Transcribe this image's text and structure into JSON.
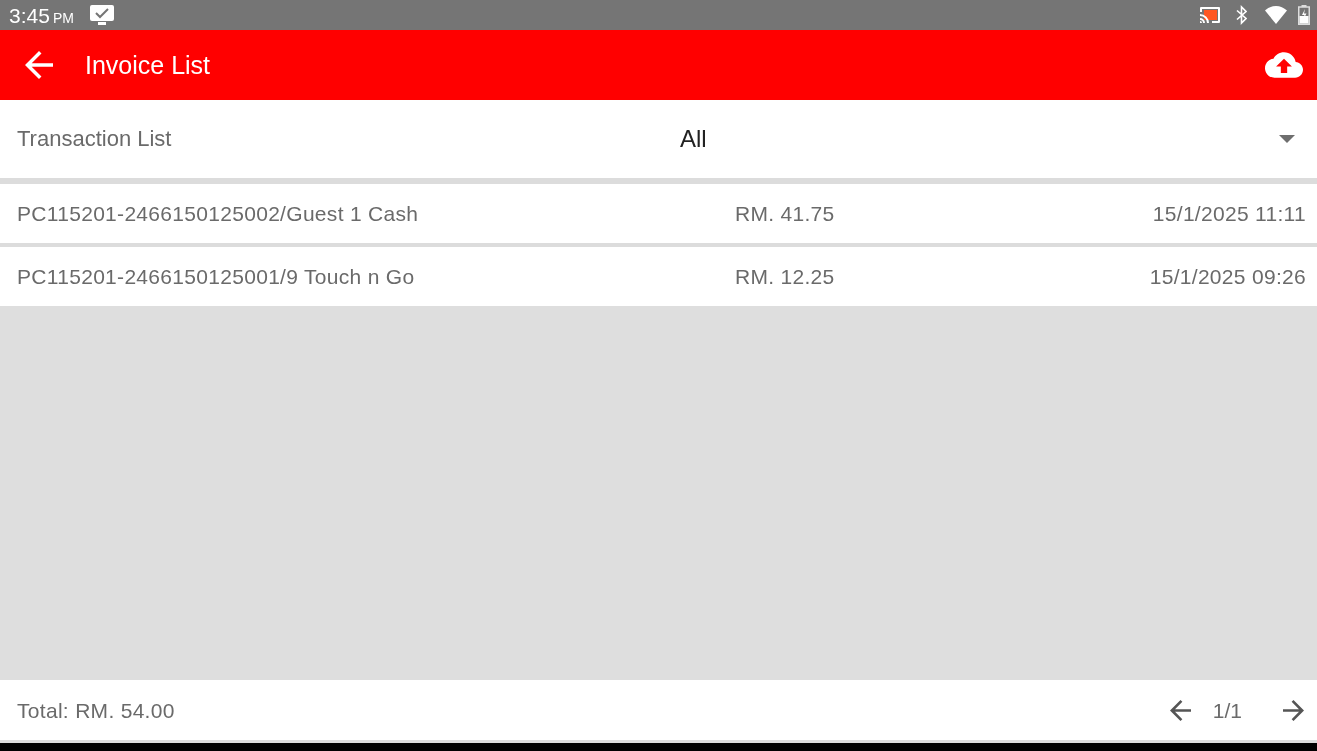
{
  "status_bar": {
    "time": "3:45",
    "meridiem": "PM"
  },
  "app_bar": {
    "title": "Invoice List"
  },
  "filter": {
    "label": "Transaction List",
    "value": "All"
  },
  "transactions": [
    {
      "reference": "PC115201-2466150125002/Guest 1 Cash",
      "amount": "RM. 41.75",
      "date": "15/1/2025 11:11"
    },
    {
      "reference": "PC115201-2466150125001/9 Touch n Go",
      "amount": "RM. 12.25",
      "date": "15/1/2025 09:26"
    }
  ],
  "footer": {
    "total": "Total: RM. 54.00",
    "page": "1/1"
  }
}
